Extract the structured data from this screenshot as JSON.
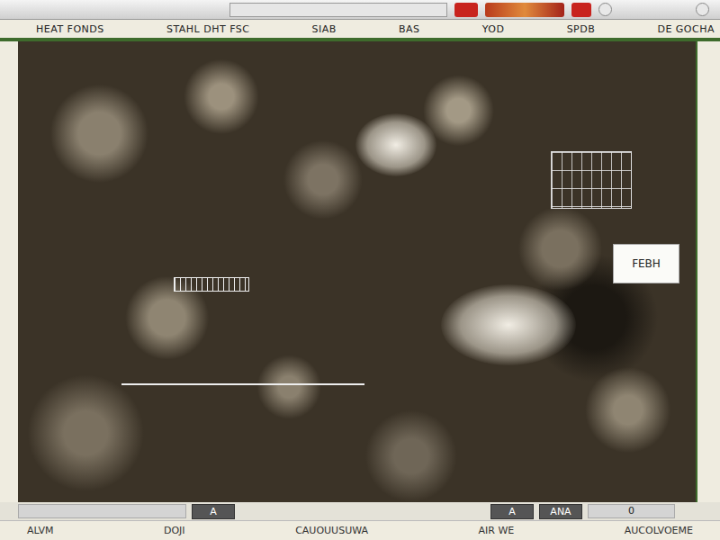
{
  "header": [
    "HEAT FONDS",
    "STAHL DHT FSC",
    "SIAB",
    "BAS",
    "YOD",
    "SPDB",
    "DE GOCHA"
  ],
  "map": {
    "label": "FEBH"
  },
  "bottom_buttons": [
    {
      "label": "A",
      "kind": "dark"
    },
    {
      "label": "A",
      "kind": "dark"
    },
    {
      "label": "ANA",
      "kind": "dark"
    },
    {
      "label": "0",
      "kind": "field"
    }
  ],
  "status": [
    "ALVM",
    "DOJI",
    "CAUOUUSUWA",
    "AIR WE",
    "AUCOLVOEME"
  ]
}
